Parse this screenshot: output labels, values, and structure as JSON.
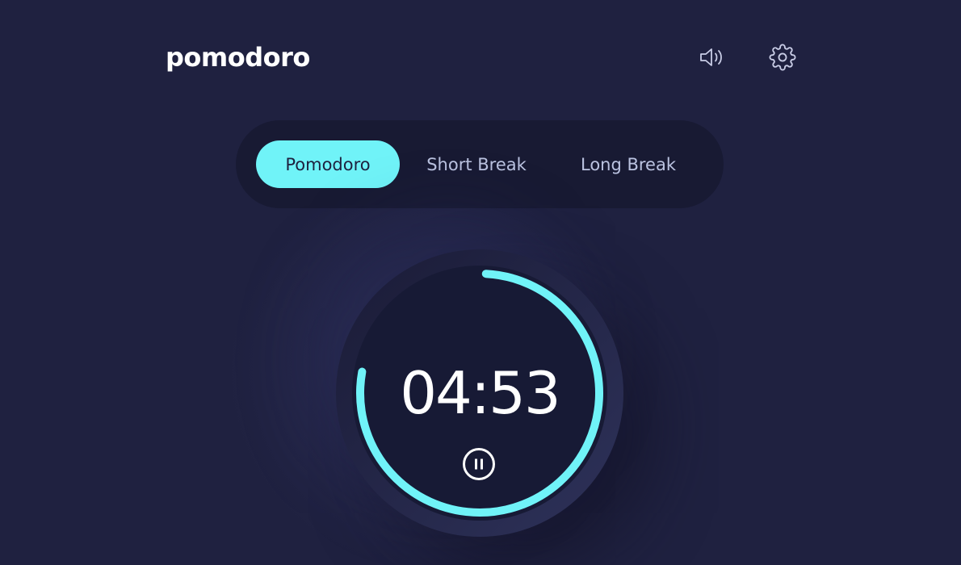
{
  "app": {
    "title": "pomodoro"
  },
  "header": {
    "sound_icon": "speaker-icon",
    "settings_icon": "gear-icon"
  },
  "modes": {
    "tabs": [
      {
        "label": "Pomodoro",
        "active": true
      },
      {
        "label": "Short Break",
        "active": false
      },
      {
        "label": "Long Break",
        "active": false
      }
    ]
  },
  "timer": {
    "time": "04:53",
    "progress_fraction": 0.77,
    "control_icon": "pause-icon",
    "accent_color": "#70f3f8"
  },
  "colors": {
    "background": "#1f2140",
    "accent": "#70f3f8"
  }
}
